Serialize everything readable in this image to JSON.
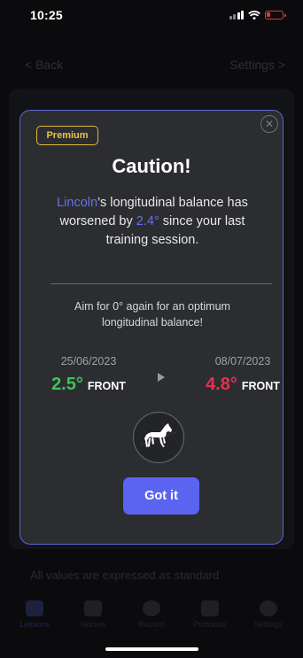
{
  "status_bar": {
    "time": "10:25"
  },
  "nav": {
    "back_label": "< Back",
    "settings_label": "Settings >"
  },
  "background": {
    "footnote": "All values are expressed as standard"
  },
  "tab_bar": {
    "items": [
      {
        "label": "Lessons"
      },
      {
        "label": "Horses"
      },
      {
        "label": "Record"
      },
      {
        "label": "Protocols"
      },
      {
        "label": "Settings"
      }
    ]
  },
  "modal": {
    "badge": "Premium",
    "title": "Caution!",
    "horse_name": "Lincoln",
    "message_part1": "’s longitudinal balance has worsened by ",
    "delta": "2.4°",
    "message_part2": " since your last training session.",
    "aim_text": "Aim for 0° again for an optimum longitudinal balance!",
    "before": {
      "date": "25/06/2023",
      "value": "2.5°",
      "direction": "FRONT"
    },
    "after": {
      "date": "08/07/2023",
      "value": "4.8°",
      "direction": "FRONT"
    },
    "button_label": "Got it",
    "close_symbol": "✕"
  },
  "colors": {
    "accent": "#5b64f0",
    "premium": "#f0c23f",
    "good": "#3ec35a",
    "bad": "#e8304f"
  },
  "icons": {
    "close": "close-icon",
    "arrow": "play-arrow-icon",
    "horse": "horse-icon"
  }
}
